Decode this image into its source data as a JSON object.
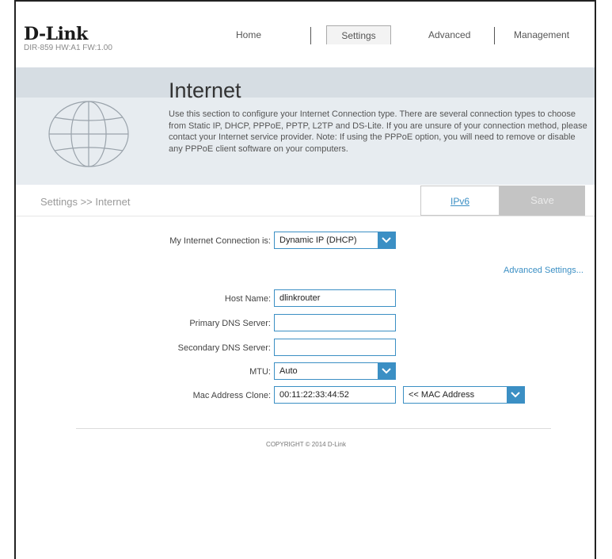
{
  "header": {
    "logo": "D-Link",
    "model_info": "DIR-859   HW:A1   FW:1.00",
    "nav": {
      "home": "Home",
      "settings": "Settings",
      "advanced": "Advanced",
      "management": "Management"
    }
  },
  "banner": {
    "title": "Internet",
    "description": "Use this section to configure your Internet Connection type. There are several connection types to choose from Static IP, DHCP, PPPoE, PPTP, L2TP and DS-Lite. If you are unsure of your connection method, please contact your Internet service provider. Note: If using the PPPoE option, you will need to remove or disable any PPPoE client software on your computers."
  },
  "subheader": {
    "breadcrumb": "Settings >> Internet",
    "ipv6_label": "IPv6",
    "save_label": "Save"
  },
  "form": {
    "connection_label": "My Internet Connection is:",
    "connection_value": "Dynamic IP (DHCP)",
    "advanced_link": "Advanced Settings...",
    "host_name_label": "Host Name:",
    "host_name_value": "dlinkrouter",
    "primary_dns_label": "Primary DNS Server:",
    "primary_dns_value": "",
    "secondary_dns_label": "Secondary DNS Server:",
    "secondary_dns_value": "",
    "mtu_label": "MTU:",
    "mtu_value": "Auto",
    "mac_clone_label": "Mac Address Clone:",
    "mac_clone_value": "00:11:22:33:44:52",
    "mac_select_value": "<< MAC Address"
  },
  "footer": {
    "copyright": "COPYRIGHT © 2014 D-Link"
  },
  "colors": {
    "accent": "#3b8fc4",
    "banner_bg": "#e7ecf0",
    "save_disabled": "#c4c4c4"
  }
}
